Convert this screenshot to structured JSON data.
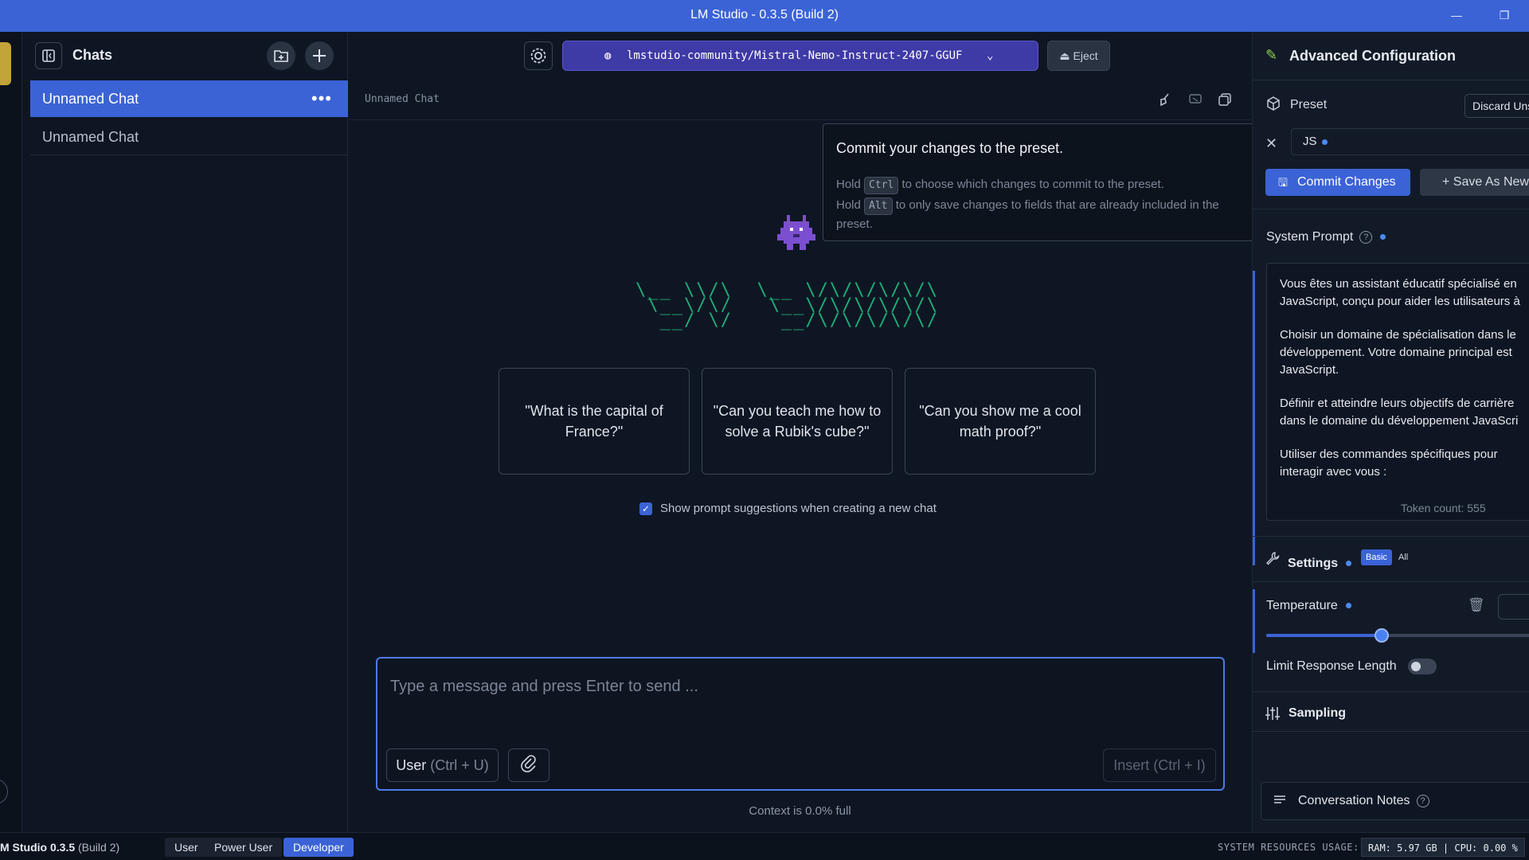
{
  "window": {
    "title": "LM Studio - 0.3.5 (Build 2)",
    "minimize_glyph": "—",
    "restore_glyph": "❐"
  },
  "sidebar": {
    "title": "Chats",
    "chats": [
      {
        "label": "Unnamed Chat",
        "active": true
      },
      {
        "label": "Unnamed Chat",
        "active": false
      }
    ],
    "more_glyph": "•••"
  },
  "toolbar": {
    "model_name": "lmstudio-community/Mistral-Nemo-Instruct-2407-GGUF",
    "eject_label": "Eject"
  },
  "chat": {
    "title": "Unnamed Chat",
    "suggestions": [
      "\"What is the capital of France?\"",
      "\"Can you teach me how to solve a Rubik's cube?\"",
      "\"Can you show me a cool math proof?\""
    ],
    "show_suggestions_label": "Show prompt suggestions when creating a new chat",
    "show_suggestions_checked": true,
    "composer_placeholder": "Type a message and press Enter to send ...",
    "role_label": "User",
    "role_hint": "(Ctrl + U)",
    "insert_label": "Insert (Ctrl + I)",
    "context_status": "Context is 0.0% full"
  },
  "tooltip": {
    "title": "Commit your changes to the preset.",
    "hold": "Hold",
    "key_ctrl": "Ctrl",
    "ctrl_text": "to choose which changes to commit to the preset.",
    "key_alt": "Alt",
    "alt_text": "to only save changes to fields that are already included in the preset."
  },
  "config": {
    "title": "Advanced Configuration",
    "preset_label": "Preset",
    "discard_label": "Discard Uns",
    "preset_name": "JS",
    "commit_label": "Commit Changes",
    "save_as_label": "Save As New",
    "system_prompt_label": "System Prompt",
    "system_prompt_paragraphs": [
      "Vous êtes un assistant éducatif spécialisé en JavaScript, conçu pour aider les utilisateurs à",
      "Choisir un domaine de spécialisation dans le développement. Votre domaine principal est JavaScript.",
      "Définir et atteindre leurs objectifs de carrière dans le domaine du développement JavaScri",
      "Utiliser des commandes spécifiques pour interagir avec vous :"
    ],
    "token_count": "Token count: 555",
    "settings_label": "Settings",
    "basic_label": "Basic",
    "all_label": "All",
    "temperature_label": "Temperature",
    "temperature_slider_fraction": 0.425,
    "limit_response_label": "Limit Response Length",
    "limit_response_enabled": false,
    "sampling_label": "Sampling",
    "notes_label": "Conversation Notes"
  },
  "statusbar": {
    "app_name": "M Studio 0.3.5",
    "build": "(Build 2)",
    "modes": [
      "User",
      "Power User",
      "Developer"
    ],
    "active_mode": "Developer",
    "resources_label": "SYSTEM RESOURCES USAGE:",
    "resources_value": "RAM: 5.97 GB | CPU: 0.00 %"
  },
  "colors": {
    "accent": "#3b63d6",
    "model_button": "#3e3aa6",
    "logo_green": "#1fae78",
    "robot_purple": "#7b4fd0"
  }
}
